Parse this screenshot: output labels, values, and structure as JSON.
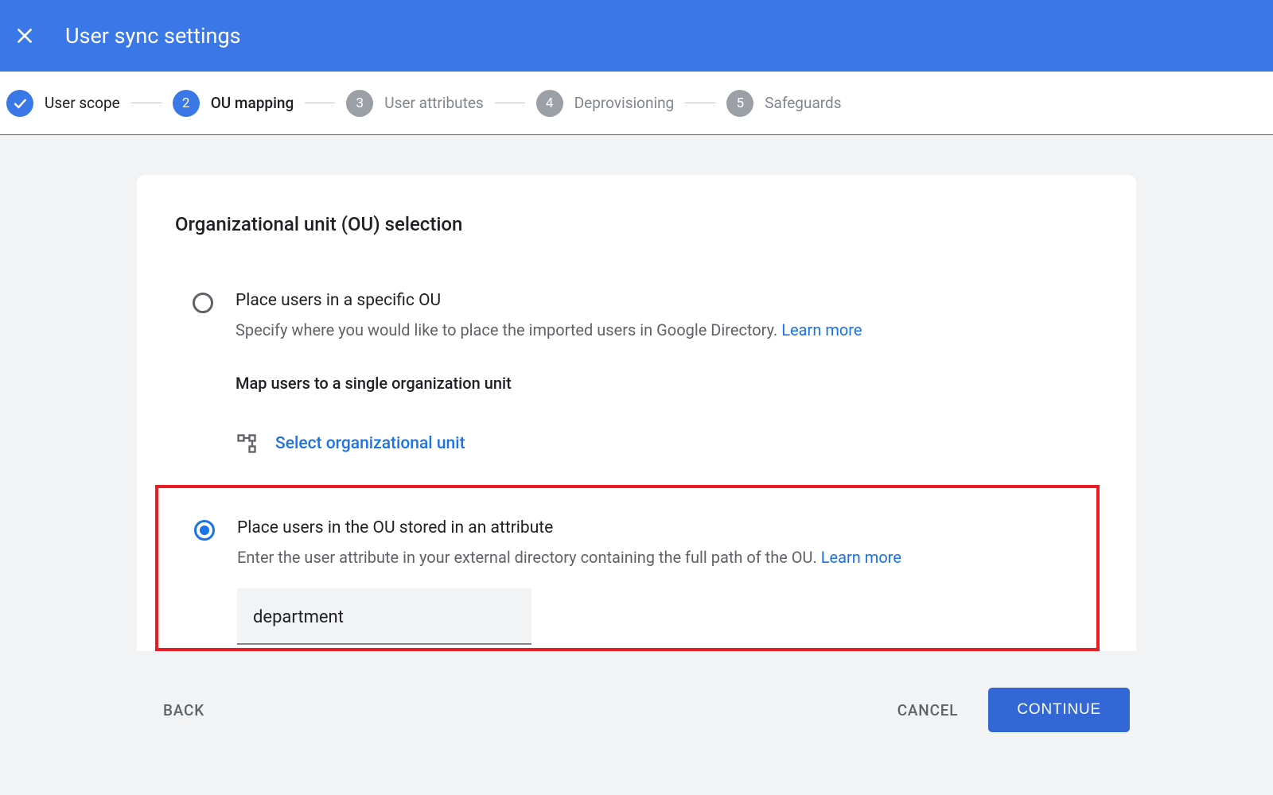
{
  "header": {
    "title": "User sync settings"
  },
  "stepper": {
    "steps": [
      {
        "label": "User scope",
        "state": "done",
        "indicator": "check"
      },
      {
        "label": "OU mapping",
        "state": "active",
        "indicator": "2"
      },
      {
        "label": "User attributes",
        "state": "pending",
        "indicator": "3"
      },
      {
        "label": "Deprovisioning",
        "state": "pending",
        "indicator": "4"
      },
      {
        "label": "Safeguards",
        "state": "pending",
        "indicator": "5"
      }
    ]
  },
  "card": {
    "title": "Organizational unit (OU) selection",
    "option1": {
      "title": "Place users in a specific OU",
      "desc": "Specify where you would like to place the imported users in Google Directory. ",
      "learn": "Learn more",
      "subhead": "Map users to a single organization unit",
      "select_label": "Select organizational unit"
    },
    "option2": {
      "title": "Place users in the OU stored in an attribute",
      "desc": "Enter the user attribute in your external directory containing the full path of the OU. ",
      "learn": "Learn more",
      "input_value": "department"
    }
  },
  "footer": {
    "back": "BACK",
    "cancel": "CANCEL",
    "continue": "CONTINUE"
  }
}
